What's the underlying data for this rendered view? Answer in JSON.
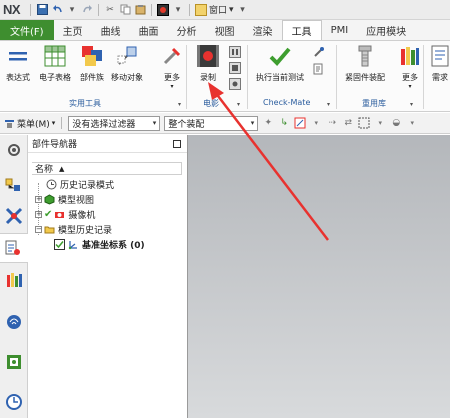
{
  "quick_access": {
    "logo": "NX",
    "window_menu": "窗口"
  },
  "tabs": [
    "文件(F)",
    "主页",
    "曲线",
    "曲面",
    "分析",
    "视图",
    "渲染",
    "工具",
    "PMI",
    "应用模块"
  ],
  "active_tab": "工具",
  "ribbon": {
    "buttons": {
      "expression": "表达式",
      "spreadsheet": "电子表格",
      "part_family": "部件族",
      "move_object": "移动对象",
      "more1": "更多",
      "record": "录制",
      "execute_test": "执行当前测试",
      "fastener_assembly": "紧固件装配",
      "more2": "更多",
      "requirements": "需求"
    },
    "groups": {
      "utility": "实用工具",
      "movie": "电影",
      "checkmate": "Check-Mate",
      "reuse": "重用库"
    }
  },
  "selection_bar": {
    "menu": "菜单(M)",
    "filter": "没有选择过滤器",
    "scope": "整个装配"
  },
  "navigator": {
    "title": "部件导航器",
    "column_name": "名称",
    "nodes": {
      "history_mode": "历史记录模式",
      "model_views": "模型视图",
      "cameras": "摄像机",
      "model_history": "模型历史记录",
      "datum_csys": "基准坐标系 (0)"
    }
  },
  "colors": {
    "file_tab": "#3e8e2f",
    "annotation_arrow": "#e8322f",
    "group_label": "#2b5d9e",
    "graphics_bg": "#c6c8cb"
  },
  "icons": [
    "save-icon",
    "undo-icon",
    "redo-icon",
    "cut-icon",
    "copy-icon",
    "paste-icon",
    "record-icon",
    "window-icon"
  ]
}
